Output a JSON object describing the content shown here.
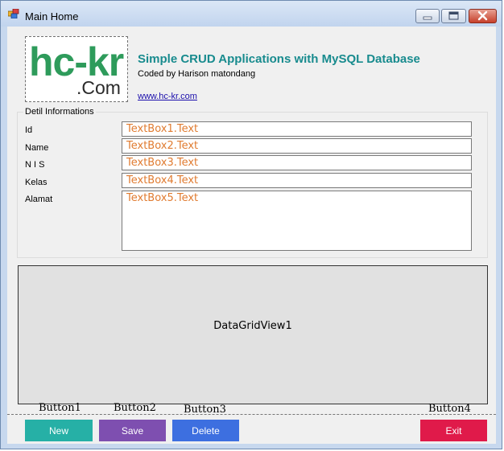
{
  "window": {
    "title": "Main Home",
    "icon": "app-form-icon",
    "controls": [
      "minimize-icon",
      "maximize-icon",
      "close-icon"
    ]
  },
  "header": {
    "logo_main": "hc-kr",
    "logo_sub": ".Com",
    "title": "Simple CRUD Applications with MySQL Database",
    "coded_by": "Coded by Harison matondang",
    "link": "www.hc-kr.com"
  },
  "details": {
    "caption": "Detil Informations",
    "fields": [
      {
        "label": "Id",
        "value": "TextBox1.Text"
      },
      {
        "label": "Name",
        "value": "TextBox2.Text"
      },
      {
        "label": "N I S",
        "value": "TextBox3.Text"
      },
      {
        "label": "Kelas",
        "value": "TextBox4.Text"
      },
      {
        "label": "Alamat",
        "value": "TextBox5.Text"
      }
    ]
  },
  "grid": {
    "label": "DataGridView1"
  },
  "buttons": [
    {
      "caption": "Button1",
      "label": "New",
      "color": "#26b0a6"
    },
    {
      "caption": "Button2",
      "label": "Save",
      "color": "#7e4fb0"
    },
    {
      "caption": "Button3",
      "label": "Delete",
      "color": "#3d6fe0"
    },
    {
      "caption": "Button4",
      "label": "Exit",
      "color": "#e01a4a"
    }
  ],
  "colors": {
    "title_accent": "#188b8e",
    "logo_green": "#2e9b5b",
    "textbox_text": "#e07b30"
  }
}
